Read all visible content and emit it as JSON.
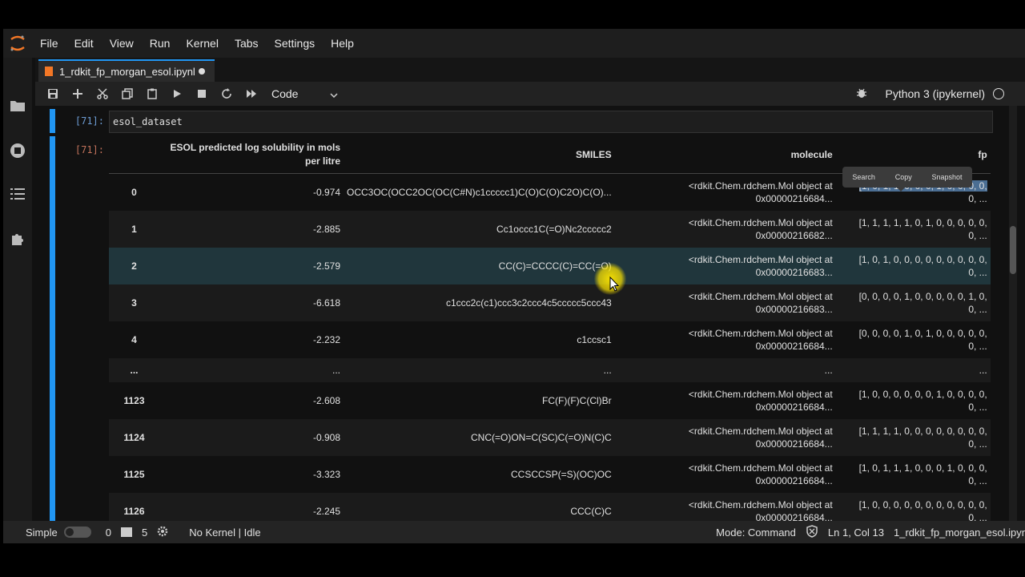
{
  "menubar": {
    "items": [
      "File",
      "Edit",
      "View",
      "Run",
      "Kernel",
      "Tabs",
      "Settings",
      "Help"
    ]
  },
  "tab": {
    "title": "1_rdkit_fp_morgan_esol.ipynl"
  },
  "toolbar": {
    "cell_type": "Code",
    "kernel_name": "Python 3 (ipykernel)"
  },
  "cells": {
    "input_prompt": "[71]:",
    "input_code": "esol_dataset",
    "output_prompt": "[71]:"
  },
  "table": {
    "headers": {
      "esol_line1": "ESOL predicted log solubility in mols",
      "esol_line2": "per litre",
      "smiles": "SMILES",
      "molecule": "molecule",
      "fp": "fp"
    },
    "rows": [
      {
        "idx": "0",
        "esol": "-0.974",
        "smiles": "OCC3OC(OCC2OC(OC(C#N)c1ccccc1)C(O)C(O)C2O)C(O)...",
        "mol1": "<rdkit.Chem.rdchem.Mol object at",
        "mol2": "0x00000216684...",
        "fp1": "[1, 0, 1, 1, 0, 0, 0, 1, 0, 0, 0, 0,",
        "fp2": "0, ..."
      },
      {
        "idx": "1",
        "esol": "-2.885",
        "smiles": "Cc1occc1C(=O)Nc2ccccc2",
        "mol1": "<rdkit.Chem.rdchem.Mol object at",
        "mol2": "0x00000216682...",
        "fp1": "[1, 1, 1, 1, 1, 0, 1, 0, 0, 0, 0, 0,",
        "fp2": "0, ..."
      },
      {
        "idx": "2",
        "esol": "-2.579",
        "smiles": "CC(C)=CCCC(C)=CC(=O)",
        "mol1": "<rdkit.Chem.rdchem.Mol object at",
        "mol2": "0x00000216683...",
        "fp1": "[1, 0, 1, 0, 0, 0, 0, 0, 0, 0, 0, 0,",
        "fp2": "0, ..."
      },
      {
        "idx": "3",
        "esol": "-6.618",
        "smiles": "c1ccc2c(c1)ccc3c2ccc4c5ccccc5ccc43",
        "mol1": "<rdkit.Chem.rdchem.Mol object at",
        "mol2": "0x00000216683...",
        "fp1": "[0, 0, 0, 0, 1, 0, 0, 0, 0, 0, 1, 0,",
        "fp2": "0, ..."
      },
      {
        "idx": "4",
        "esol": "-2.232",
        "smiles": "c1ccsc1",
        "mol1": "<rdkit.Chem.rdchem.Mol object at",
        "mol2": "0x00000216684...",
        "fp1": "[0, 0, 0, 0, 1, 0, 1, 0, 0, 0, 0, 0,",
        "fp2": "0, ..."
      },
      {
        "idx": "...",
        "esol": "...",
        "smiles": "...",
        "mol1": "...",
        "mol2": "",
        "fp1": "...",
        "fp2": ""
      },
      {
        "idx": "1123",
        "esol": "-2.608",
        "smiles": "FC(F)(F)C(Cl)Br",
        "mol1": "<rdkit.Chem.rdchem.Mol object at",
        "mol2": "0x00000216684...",
        "fp1": "[1, 0, 0, 0, 0, 0, 0, 1, 0, 0, 0, 0,",
        "fp2": "0, ..."
      },
      {
        "idx": "1124",
        "esol": "-0.908",
        "smiles": "CNC(=O)ON=C(SC)C(=O)N(C)C",
        "mol1": "<rdkit.Chem.rdchem.Mol object at",
        "mol2": "0x00000216684...",
        "fp1": "[1, 1, 1, 1, 0, 0, 0, 0, 0, 0, 0, 0,",
        "fp2": "0, ..."
      },
      {
        "idx": "1125",
        "esol": "-3.323",
        "smiles": "CCSCCSP(=S)(OC)OC",
        "mol1": "<rdkit.Chem.rdchem.Mol object at",
        "mol2": "0x00000216684...",
        "fp1": "[1, 0, 1, 1, 1, 0, 0, 0, 1, 0, 0, 0,",
        "fp2": "0, ..."
      },
      {
        "idx": "1126",
        "esol": "-2.245",
        "smiles": "CCC(C)C",
        "mol1": "<rdkit.Chem.rdchem.Mol object at",
        "mol2": "0x00000216684...",
        "fp1": "[1, 0, 0, 0, 0, 0, 0, 0, 0, 0, 0, 0,",
        "fp2": "0, ..."
      }
    ]
  },
  "popup": {
    "search": "Search",
    "copy": "Copy",
    "snapshot": "Snapshot"
  },
  "statusbar": {
    "mode_label": "Simple",
    "terminals": "0",
    "kernels": "5",
    "kernel_status": "No Kernel | Idle",
    "mode": "Mode: Command",
    "position": "Ln 1, Col 13",
    "filename": "1_rdkit_fp_morgan_esol.ipynb"
  },
  "colors": {
    "accent": "#2196f3",
    "highlight_row": "#20363c",
    "selection": "#4b6e93"
  }
}
